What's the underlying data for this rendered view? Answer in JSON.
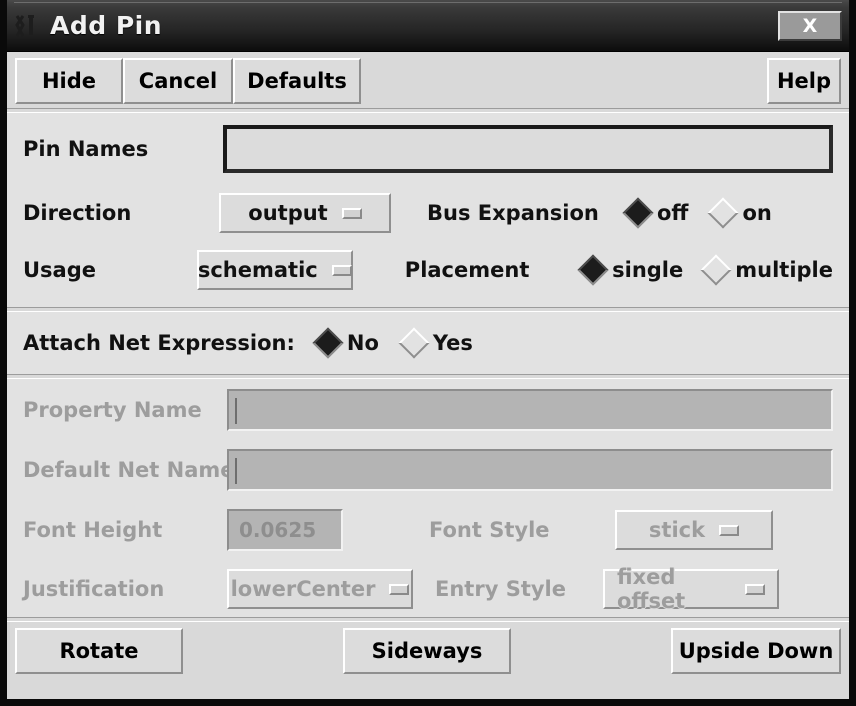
{
  "window": {
    "title": "Add Pin",
    "icon": "app-icon",
    "close_label": "X"
  },
  "toolbar": {
    "hide_label": "Hide",
    "cancel_label": "Cancel",
    "defaults_label": "Defaults",
    "help_label": "Help"
  },
  "form": {
    "pin_names": {
      "label": "Pin Names",
      "value": ""
    },
    "direction": {
      "label": "Direction",
      "value": "output"
    },
    "bus_expansion": {
      "label": "Bus Expansion",
      "options": [
        "off",
        "on"
      ],
      "selected": "off"
    },
    "usage": {
      "label": "Usage",
      "value": "schematic"
    },
    "placement": {
      "label": "Placement",
      "options": [
        "single",
        "multiple"
      ],
      "selected": "single"
    },
    "attach_net_expression": {
      "label": "Attach Net Expression:",
      "options": [
        "No",
        "Yes"
      ],
      "selected": "No"
    },
    "property_name": {
      "label": "Property Name",
      "value": "",
      "disabled": true
    },
    "default_net_name": {
      "label": "Default Net Name",
      "value": "",
      "disabled": true
    },
    "font_height": {
      "label": "Font Height",
      "value": "0.0625",
      "disabled": true
    },
    "font_style": {
      "label": "Font Style",
      "value": "stick",
      "disabled": true
    },
    "justification": {
      "label": "Justification",
      "value": "lowerCenter",
      "disabled": true
    },
    "entry_style": {
      "label": "Entry Style",
      "value": "fixed offset",
      "disabled": true
    }
  },
  "bottom": {
    "rotate_label": "Rotate",
    "sideways_label": "Sideways",
    "upside_down_label": "Upside Down"
  },
  "colors": {
    "window_bg": "#d9d9d9",
    "form_bg": "#e2e2e2",
    "titlebar_dark": "#0c0c0c",
    "disabled_text": "#9d9d9d",
    "field_border": "#1a1a1a"
  }
}
